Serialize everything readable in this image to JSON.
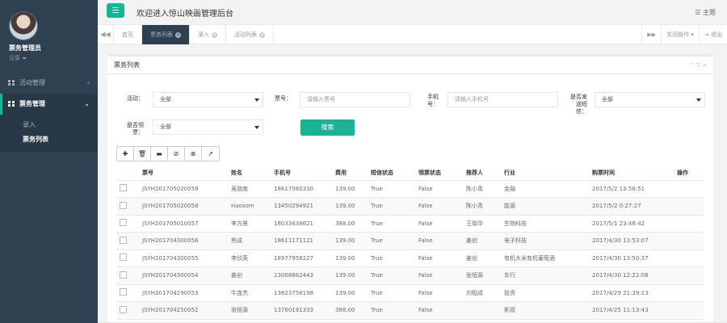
{
  "sidebar": {
    "user_name": "票务管理员",
    "user_role": "设置",
    "nav": [
      {
        "label": "活动管理",
        "arrow": "‹"
      },
      {
        "label": "票务管理",
        "arrow": "⌄"
      }
    ],
    "sub_items": [
      "录入",
      "票务列表"
    ]
  },
  "topbar": {
    "welcome": "欢迎进入惊山映画管理后台",
    "theme": "主题"
  },
  "tabs": {
    "items": [
      "首页",
      "票务列表",
      "录入",
      "活动列表"
    ],
    "close_menu": "关闭操作",
    "logout": "退出"
  },
  "panel": {
    "title": "票务列表",
    "tools": "⌃ ⚲ ✕"
  },
  "form": {
    "activity_label": "活动：",
    "activity_value": "全部",
    "ticket_label": "票号：",
    "ticket_placeholder": "请输入票号",
    "phone_label_1": "手机",
    "phone_label_2": "号：",
    "phone_placeholder": "请输入手机号",
    "sms_label_1": "是否发",
    "sms_label_2": "送短",
    "sms_label_3": "信：",
    "sms_value": "全部",
    "collect_label_1": "是否领",
    "collect_label_2": "票：",
    "collect_value": "全部",
    "search_button": "搜索"
  },
  "table": {
    "headers": [
      "",
      "票号",
      "姓名",
      "手机号",
      "费用",
      "短信状态",
      "领票状态",
      "推荐人",
      "行业",
      "购票时间",
      "操作"
    ],
    "rows": [
      [
        "",
        "JSYH201705020059",
        "吴骁南",
        "18617060330",
        "139.00",
        "True",
        "False",
        "陈小青",
        "金融",
        "2017/5/2 13:56:51",
        ""
      ],
      [
        "",
        "JSYH201705020058",
        "Haosom",
        "13450294921",
        "139.00",
        "True",
        "False",
        "陈小青",
        "能源",
        "2017/5/2 0:27:27",
        ""
      ],
      [
        "",
        "JSYH201705010057",
        "李方景",
        "18033438621",
        "388.00",
        "True",
        "False",
        "王晓华",
        "生物科技",
        "2017/5/1 23:46:42",
        ""
      ],
      [
        "",
        "JSYH201704300056",
        "熊成",
        "18611171121",
        "139.00",
        "True",
        "False",
        "姜创",
        "电子科技",
        "2017/4/30 13:53:07",
        ""
      ],
      [
        "",
        "JSYH201704300055",
        "李欣英",
        "18977958227",
        "139.00",
        "True",
        "False",
        "姜创",
        "有机大米有机葡萄酒",
        "2017/4/30 13:50:37",
        ""
      ],
      [
        "",
        "JSYH201704300054",
        "姜创",
        "13008862443",
        "139.00",
        "True",
        "False",
        "张恒源",
        "车行",
        "2017/4/30 12:22:08",
        ""
      ],
      [
        "",
        "JSYH201704290053",
        "牛连杰",
        "13823758198",
        "139.00",
        "True",
        "False",
        "刘相成",
        "投资",
        "2017/4/29 21:39:13",
        ""
      ],
      [
        "",
        "JSYH201704250052",
        "张恒源",
        "13760191333",
        "388.00",
        "True",
        "False",
        "",
        "影视",
        "2017/4/25 11:13:43",
        ""
      ]
    ]
  }
}
